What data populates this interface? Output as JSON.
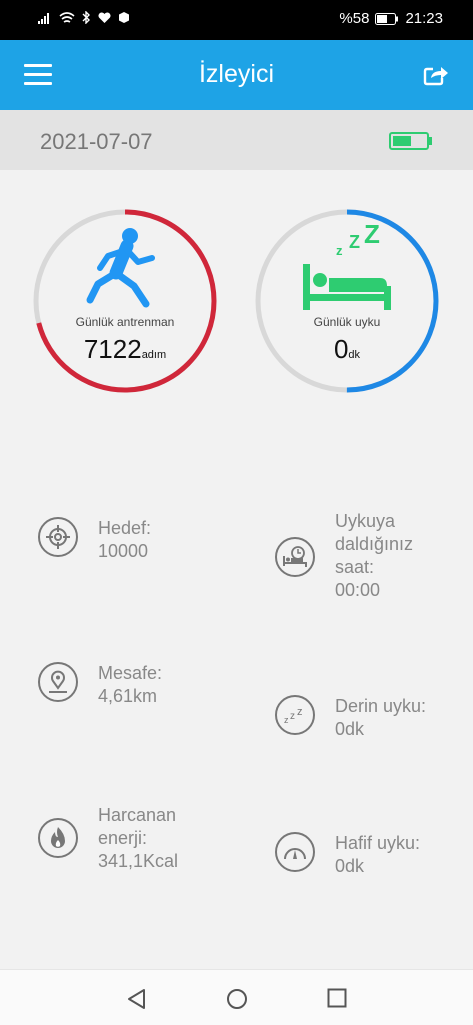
{
  "status_bar": {
    "battery_text": "%58",
    "time": "21:23"
  },
  "app_bar": {
    "title": "İzleyici",
    "menu_icon": "hamburger-menu-icon",
    "share_icon": "share-icon"
  },
  "date_bar": {
    "date": "2021-07-07",
    "battery_icon": "device-battery-icon"
  },
  "activity_ring": {
    "label": "Günlük antrenman",
    "value": "7122",
    "unit": "adım",
    "progress": 0.71,
    "color": "#d0273a"
  },
  "sleep_ring": {
    "label": "Günlük uyku",
    "value": "0",
    "unit": "dk",
    "progress": 0.5,
    "color": "#1e88e5"
  },
  "stats_left": [
    {
      "icon": "target-icon",
      "text": "Hedef:\n10000"
    },
    {
      "icon": "location-pin-icon",
      "text": "Mesafe:\n4,61km"
    },
    {
      "icon": "flame-icon",
      "text": "Harcanan\nenerji:\n341,1Kcal"
    }
  ],
  "stats_right": [
    {
      "icon": "bed-clock-icon",
      "text": "Uykuya\ndaldığınız\nsaat:\n00:00"
    },
    {
      "icon": "deep-sleep-icon",
      "text": "Derin uyku:\n0dk"
    },
    {
      "icon": "light-sleep-gauge-icon",
      "text": "Hafif uyku:\n0dk"
    }
  ],
  "nav_bar": {
    "back_icon": "back-icon",
    "home_icon": "home-icon",
    "recents_icon": "recents-icon"
  }
}
